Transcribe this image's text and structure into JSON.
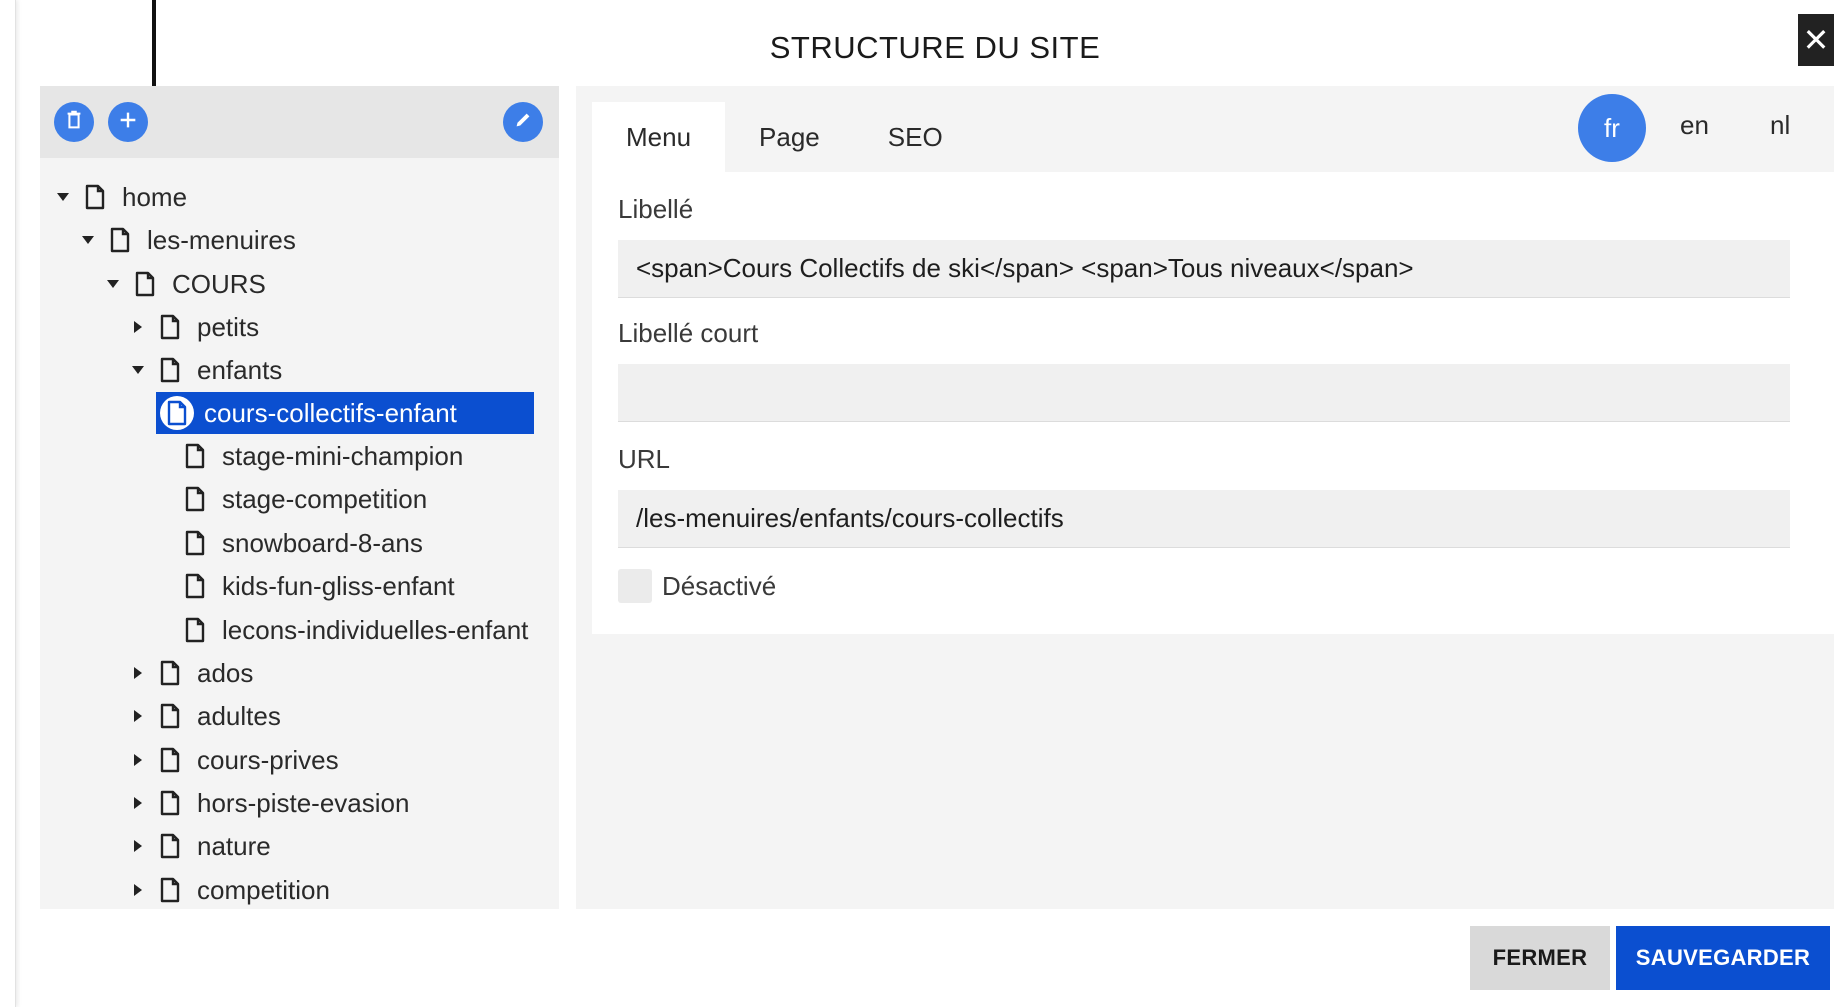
{
  "modal": {
    "title": "STRUCTURE DU SITE",
    "close_label": "✕"
  },
  "toolbar": {
    "delete_icon": "trash-icon",
    "add_icon": "plus-icon",
    "edit_icon": "pencil-icon"
  },
  "tree": {
    "items": [
      {
        "label": "home",
        "expanded": true
      },
      {
        "label": "les-menuires",
        "expanded": true
      },
      {
        "label": "COURS",
        "expanded": true
      },
      {
        "label": "petits",
        "expanded": false
      },
      {
        "label": "enfants",
        "expanded": true
      },
      {
        "label": "cours-collectifs-enfant",
        "selected": true
      },
      {
        "label": "stage-mini-champion"
      },
      {
        "label": "stage-competition"
      },
      {
        "label": "snowboard-8-ans"
      },
      {
        "label": "kids-fun-gliss-enfant"
      },
      {
        "label": "lecons-individuelles-enfant"
      },
      {
        "label": "ados",
        "expanded": false
      },
      {
        "label": "adultes",
        "expanded": false
      },
      {
        "label": "cours-prives",
        "expanded": false
      },
      {
        "label": "hors-piste-evasion",
        "expanded": false
      },
      {
        "label": "nature",
        "expanded": false
      },
      {
        "label": "competition",
        "expanded": false
      }
    ]
  },
  "tabs": [
    {
      "label": "Menu",
      "active": true
    },
    {
      "label": "Page"
    },
    {
      "label": "SEO"
    }
  ],
  "languages": [
    {
      "label": "fr",
      "active": true
    },
    {
      "label": "en"
    },
    {
      "label": "nl"
    }
  ],
  "form": {
    "libelle_label": "Libellé",
    "libelle_value": "<span>Cours Collectifs de ski</span> <span>Tous niveaux</span>",
    "libelle_court_label": "Libellé court",
    "libelle_court_value": "",
    "url_label": "URL",
    "url_value": "/les-menuires/enfants/cours-collectifs",
    "desactive_label": "Désactivé",
    "desactive_checked": false
  },
  "footer": {
    "close_label": "FERMER",
    "save_label": "SAUVEGARDER"
  },
  "colors": {
    "accent": "#3d7ee8",
    "selected": "#0b4fd0",
    "panel_bg": "#f4f4f4"
  }
}
